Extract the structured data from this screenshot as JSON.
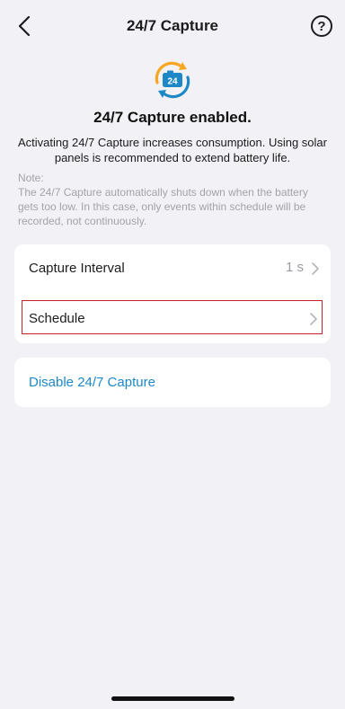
{
  "header": {
    "title": "24/7 Capture",
    "help_label": "?"
  },
  "hero": {
    "badge_text": "24",
    "headline": "24/7 Capture enabled.",
    "description": "Activating 24/7 Capture increases consumption. Using solar panels is recommended to extend battery life.",
    "note": "Note:\nThe 24/7 Capture automatically shuts down when the battery gets too low. In this case, only events within schedule will be recorded, not continuously."
  },
  "settings": {
    "capture_interval_label": "Capture Interval",
    "capture_interval_value": "1 s",
    "schedule_label": "Schedule"
  },
  "actions": {
    "disable_label": "Disable 24/7 Capture"
  },
  "colors": {
    "background": "#f2f2f6",
    "accent_blue": "#1e88c7",
    "highlight_red": "#c8202c",
    "icon_orange": "#f5a623",
    "icon_blue": "#1e88c7"
  },
  "icons": {
    "back": "chevron-left-icon",
    "help": "question-circle-icon",
    "hero": "camera-24-icon",
    "row_chevron": "chevron-right-icon"
  }
}
